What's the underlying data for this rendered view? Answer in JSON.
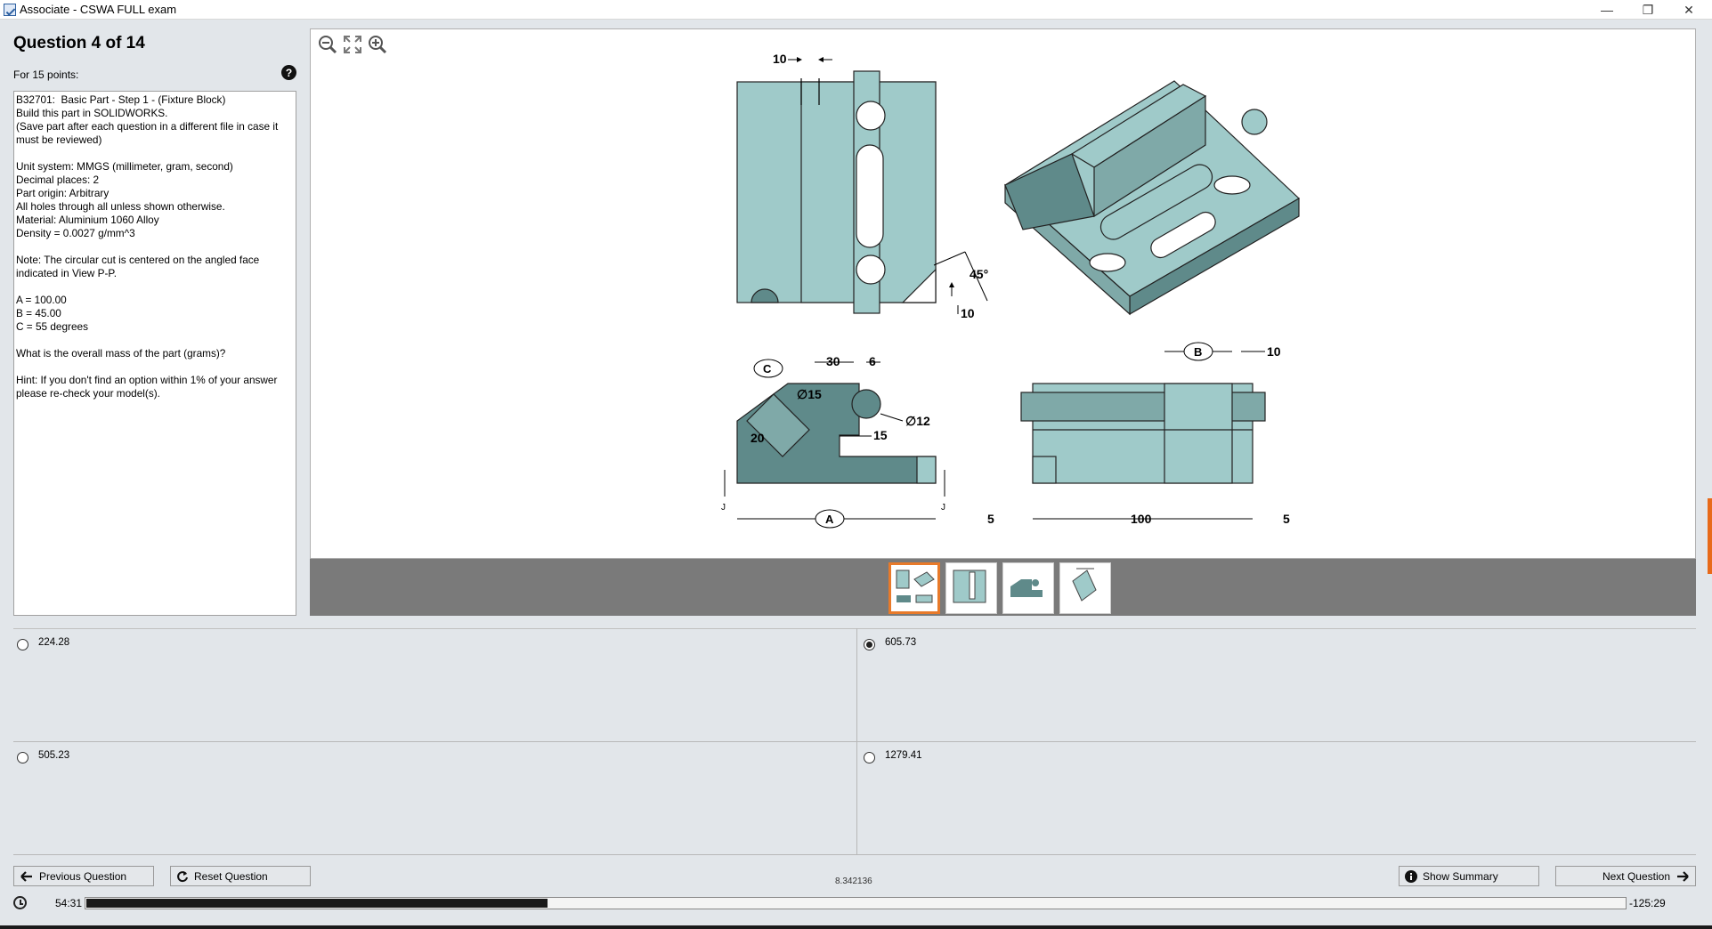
{
  "window": {
    "title": "Associate - CSWA FULL exam",
    "minimize": "—",
    "restore": "❐",
    "close": "✕"
  },
  "question": {
    "title": "Question 4 of 14",
    "points": "For 15 points:",
    "help": "?",
    "text": "B32701:  Basic Part - Step 1 - (Fixture Block)\nBuild this part in SOLIDWORKS.\n(Save part after each question in a different file in case it must be reviewed)\n\nUnit system: MMGS (millimeter, gram, second)\nDecimal places: 2\nPart origin: Arbitrary\nAll holes through all unless shown otherwise.\nMaterial: Aluminium 1060 Alloy\nDensity = 0.0027 g/mm^3\n\nNote: The circular cut is centered on the angled face indicated in View P-P.\n\nA = 100.00\nB = 45.00\nC = 55 degrees\n\nWhat is the overall mass of the part (grams)?\n\nHint: If you don't find an option within 1% of your answer please re-check your model(s)."
  },
  "viewer": {
    "tools": [
      "zoom-out-icon",
      "fit-icon",
      "zoom-in-icon"
    ],
    "part_color": "#9fcac9",
    "dark_face_color": "#5f8a8a",
    "dimensions": {
      "top_width": "10",
      "angle": "45°",
      "bottom_offset": "10",
      "c_label": "C",
      "dim_30": "30",
      "dim_6": "6",
      "dia_15": "∅15",
      "dia_12": "∅12",
      "dim_15": "15",
      "dim_20": "20",
      "a_label": "A",
      "section_mark_left": "J",
      "section_mark_right": "J",
      "b_label": "B",
      "right_10": "10",
      "left_5": "5",
      "dim_100": "100",
      "right_5": "5"
    },
    "thumbnails": [
      {
        "name": "thumbnail-1",
        "selected": true
      },
      {
        "name": "thumbnail-2",
        "selected": false
      },
      {
        "name": "thumbnail-3",
        "selected": false
      },
      {
        "name": "thumbnail-4",
        "selected": false
      }
    ]
  },
  "answers": [
    {
      "label": "224.28",
      "selected": false
    },
    {
      "label": "605.73",
      "selected": true
    },
    {
      "label": "505.23",
      "selected": false
    },
    {
      "label": "1279.41",
      "selected": false
    }
  ],
  "nav": {
    "previous": "Previous Question",
    "reset": "Reset Question",
    "summary": "Show Summary",
    "next": "Next Question",
    "build_id": "8.342136"
  },
  "timer": {
    "elapsed": "54:31",
    "remaining": "-125:29",
    "progress_fraction": 0.3
  }
}
